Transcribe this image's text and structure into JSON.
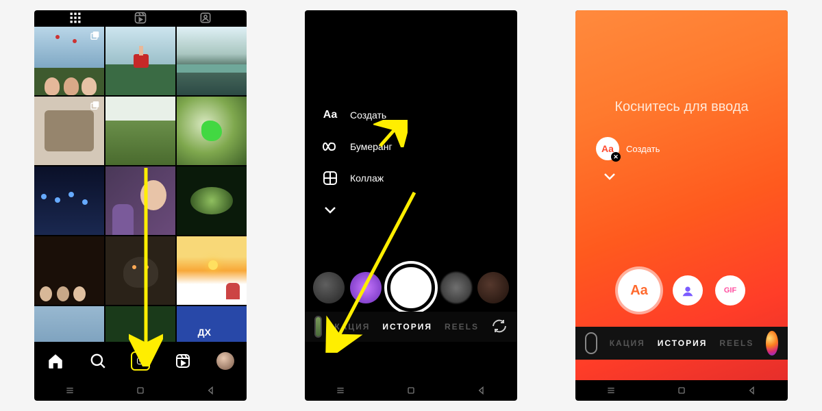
{
  "screen1": {
    "tabs": [
      "grid",
      "reels",
      "tagged"
    ],
    "active_tab_index": 0,
    "grid_tiles": [
      {
        "is_multi": true
      },
      {
        "is_multi": false
      },
      {
        "is_multi": false
      },
      {
        "is_multi": true
      },
      {
        "is_multi": false
      },
      {
        "is_multi": false
      },
      {
        "is_multi": false
      },
      {
        "is_multi": false
      },
      {
        "is_multi": false
      },
      {
        "is_multi": false
      },
      {
        "is_multi": false
      },
      {
        "is_multi": false
      },
      {
        "is_multi": false
      },
      {
        "is_multi": false
      },
      {
        "is_multi": false
      }
    ],
    "bottom_nav": [
      "home",
      "search",
      "create",
      "reels",
      "profile"
    ],
    "highlighted_nav_index": 2
  },
  "screen2": {
    "modes": [
      {
        "icon": "text-aa-icon",
        "label": "Создать"
      },
      {
        "icon": "infinity-icon",
        "label": "Бумеранг"
      },
      {
        "icon": "layout-icon",
        "label": "Коллаж"
      },
      {
        "icon": "chevron-down-icon",
        "label": ""
      }
    ],
    "bottom_tabs": {
      "left_cut": "КАЦИЯ",
      "center": "ИСТОРИЯ",
      "right": "REELS"
    }
  },
  "screen3": {
    "prompt": "Коснитесь для ввода",
    "chip_label": "Создать",
    "chip_icon_text": "Aa",
    "actions": [
      {
        "icon": "text-aa-icon",
        "text": "Aa",
        "big": true,
        "color": "#ff5a1e"
      },
      {
        "icon": "mention-icon",
        "text": "",
        "big": false,
        "color": "#7b5cff"
      },
      {
        "icon": "gif-icon",
        "text": "GIF",
        "big": false,
        "color": "#ff4fa0"
      }
    ],
    "bottom_tabs": {
      "left_cut": "КАЦИЯ",
      "center": "ИСТОРИЯ",
      "right": "REELS"
    }
  },
  "android_nav": [
    "menu",
    "home",
    "back"
  ],
  "annotations": {
    "arrow_color": "#ffee00"
  }
}
